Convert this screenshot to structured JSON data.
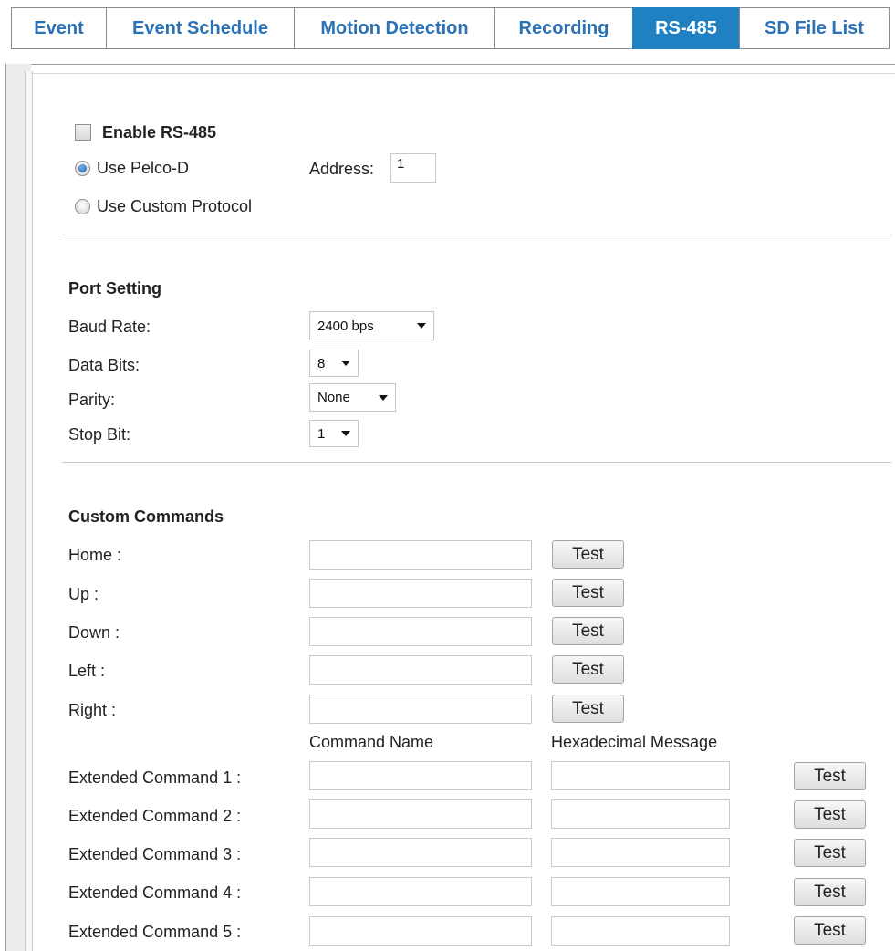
{
  "tabs": [
    {
      "label": "Event",
      "active": false
    },
    {
      "label": "Event Schedule",
      "active": false
    },
    {
      "label": "Motion Detection",
      "active": false
    },
    {
      "label": "Recording",
      "active": false
    },
    {
      "label": "RS-485",
      "active": true
    },
    {
      "label": "SD File List",
      "active": false
    }
  ],
  "rs485": {
    "enable_label": "Enable RS-485",
    "enabled": false,
    "pelco_label": "Use Pelco-D",
    "custom_label": "Use Custom Protocol",
    "selected_protocol": "Use Pelco-D",
    "address_label": "Address:",
    "address_value": "1"
  },
  "port_setting": {
    "title": "Port Setting",
    "baud_label": "Baud Rate:",
    "baud_value": "2400 bps",
    "data_bits_label": "Data Bits:",
    "data_bits_value": "8",
    "parity_label": "Parity:",
    "parity_value": "None",
    "stop_bit_label": "Stop Bit:",
    "stop_bit_value": "1"
  },
  "custom_commands": {
    "title": "Custom Commands",
    "test_label": "Test",
    "commands": [
      {
        "label": "Home :",
        "value": ""
      },
      {
        "label": "Up :",
        "value": ""
      },
      {
        "label": "Down :",
        "value": ""
      },
      {
        "label": "Left :",
        "value": ""
      },
      {
        "label": "Right :",
        "value": ""
      }
    ],
    "col_command_name": "Command Name",
    "col_hex_message": "Hexadecimal Message",
    "extended": [
      {
        "label": "Extended Command 1 :",
        "name": "",
        "hex": ""
      },
      {
        "label": "Extended Command 2 :",
        "name": "",
        "hex": ""
      },
      {
        "label": "Extended Command 3 :",
        "name": "",
        "hex": ""
      },
      {
        "label": "Extended Command 4 :",
        "name": "",
        "hex": ""
      },
      {
        "label": "Extended Command 5 :",
        "name": "",
        "hex": ""
      }
    ]
  },
  "colors": {
    "tab_active_bg": "#1f80c2",
    "tab_text": "#2a72b5"
  }
}
